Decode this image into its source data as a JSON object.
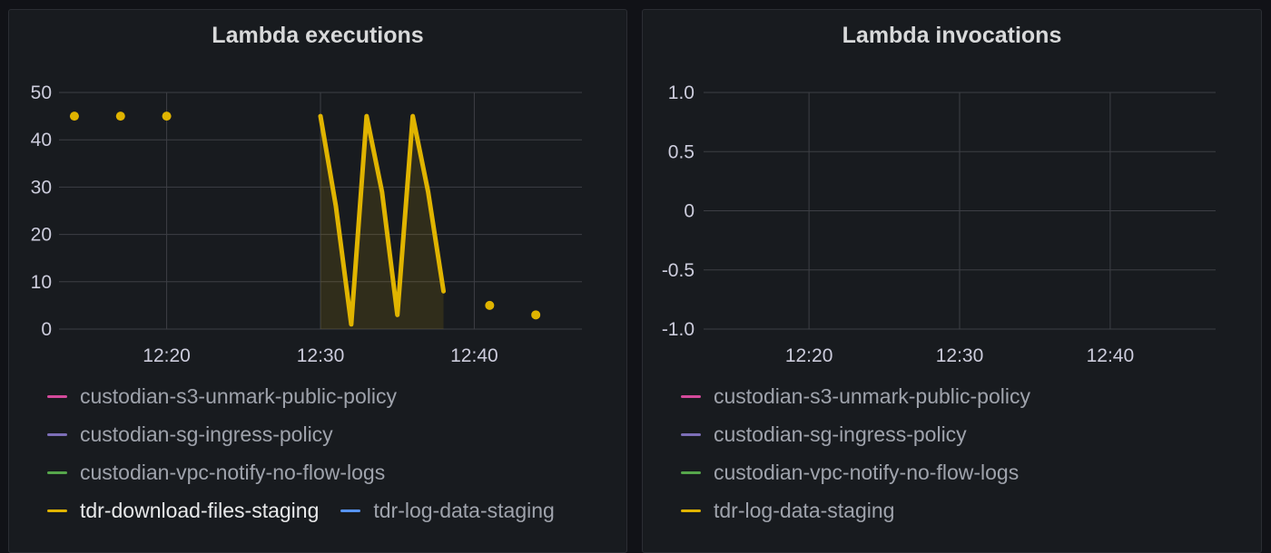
{
  "colors": {
    "background": "#111217",
    "panel": "#181b1f",
    "grid": "#3d3f45",
    "series_yellow": "#e0b400",
    "series_magenta": "#d44a9b",
    "series_purple": "#7d6fb8",
    "series_green": "#56a64b",
    "series_blue": "#5794f2"
  },
  "chart_data": [
    {
      "type": "line",
      "title": "Lambda executions",
      "xlabel": "",
      "ylabel": "",
      "x_ticks": [
        "12:20",
        "12:30",
        "12:40"
      ],
      "y_ticks": [
        "0",
        "10",
        "20",
        "30",
        "40",
        "50"
      ],
      "ylim": [
        0,
        50
      ],
      "xlim": [
        "12:13",
        "12:47"
      ],
      "grid": true,
      "legend_position": "bottom",
      "legend": [
        {
          "name": "custodian-s3-unmark-public-policy",
          "color": "#d44a9b"
        },
        {
          "name": "custodian-sg-ingress-policy",
          "color": "#7d6fb8"
        },
        {
          "name": "custodian-vpc-notify-no-flow-logs",
          "color": "#56a64b"
        },
        {
          "name": "tdr-download-files-staging",
          "color": "#e0b400",
          "active": true
        },
        {
          "name": "tdr-log-data-staging",
          "color": "#5794f2"
        }
      ],
      "series": [
        {
          "name": "tdr-download-files-staging",
          "color": "#e0b400",
          "points": [
            {
              "x": "12:14",
              "y": 45
            },
            {
              "x": "12:17",
              "y": 45
            },
            {
              "x": "12:20",
              "y": 45
            },
            {
              "x": "12:30",
              "y": 45
            },
            {
              "x": "12:31",
              "y": 26
            },
            {
              "x": "12:32",
              "y": 1
            },
            {
              "x": "12:33",
              "y": 45
            },
            {
              "x": "12:34",
              "y": 29
            },
            {
              "x": "12:35",
              "y": 3
            },
            {
              "x": "12:36",
              "y": 45
            },
            {
              "x": "12:37",
              "y": 29
            },
            {
              "x": "12:38",
              "y": 8
            },
            {
              "x": "12:41",
              "y": 5
            },
            {
              "x": "12:44",
              "y": 3
            }
          ],
          "line_range": [
            "12:30",
            "12:38"
          ]
        }
      ]
    },
    {
      "type": "line",
      "title": "Lambda invocations",
      "xlabel": "",
      "ylabel": "",
      "x_ticks": [
        "12:20",
        "12:30",
        "12:40"
      ],
      "y_ticks": [
        "-1.0",
        "-0.5",
        "0",
        "0.5",
        "1.0"
      ],
      "ylim": [
        -1,
        1
      ],
      "xlim": [
        "12:13",
        "12:47"
      ],
      "grid": true,
      "legend_position": "bottom",
      "legend": [
        {
          "name": "custodian-s3-unmark-public-policy",
          "color": "#d44a9b"
        },
        {
          "name": "custodian-sg-ingress-policy",
          "color": "#7d6fb8"
        },
        {
          "name": "custodian-vpc-notify-no-flow-logs",
          "color": "#56a64b"
        },
        {
          "name": "tdr-log-data-staging",
          "color": "#e0b400"
        }
      ],
      "series": []
    }
  ]
}
